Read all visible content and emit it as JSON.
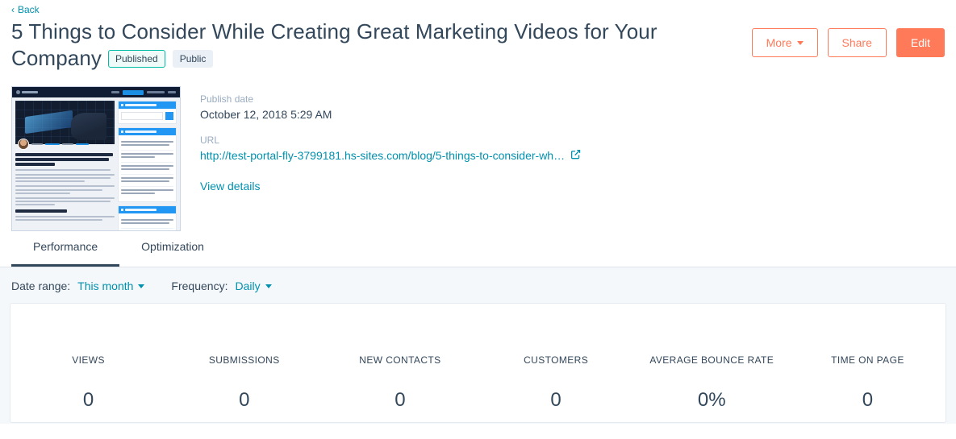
{
  "back": {
    "label": "Back",
    "icon": "chevron-left-icon"
  },
  "header": {
    "title": "5 Things to Consider While Creating Great Marketing Videos for Your Company",
    "badges": [
      {
        "label": "Published",
        "color": "#00bda5"
      },
      {
        "label": "Public",
        "color": "#eaf0f6"
      }
    ],
    "actions": [
      {
        "label": "More",
        "style": "secondary",
        "icon": "caret-down-icon"
      },
      {
        "label": "Share",
        "style": "secondary"
      },
      {
        "label": "Edit",
        "style": "primary"
      }
    ],
    "accent_color": "#ff7a59"
  },
  "preview": {
    "thumbnail_name": "blog-post-preview-thumbnail",
    "post_title": "5 Things to Consider While Creating Great Marketing Videos for Your Company",
    "section_heading": "1. Know Your Audience",
    "sidebar_widgets": [
      "Blog Search",
      "Posts Popular",
      "Recent Posts"
    ]
  },
  "details": {
    "publish_date_label": "Publish date",
    "publish_date": "October 12, 2018 5:29 AM",
    "url_label": "URL",
    "url": "http://test-portal-fly-3799181.hs-sites.com/blog/5-things-to-consider-wh…",
    "url_icon": "external-link-icon",
    "view_details": "View details"
  },
  "tabs": [
    {
      "label": "Performance",
      "active": true
    },
    {
      "label": "Optimization",
      "active": false
    }
  ],
  "filters": {
    "date_range_label": "Date range:",
    "date_range_value": "This month",
    "frequency_label": "Frequency:",
    "frequency_value": "Daily"
  },
  "metrics": [
    {
      "label": "VIEWS",
      "value": "0"
    },
    {
      "label": "SUBMISSIONS",
      "value": "0"
    },
    {
      "label": "NEW CONTACTS",
      "value": "0"
    },
    {
      "label": "CUSTOMERS",
      "value": "0"
    },
    {
      "label": "AVERAGE BOUNCE RATE",
      "value": "0%"
    },
    {
      "label": "TIME ON PAGE",
      "value": "0"
    }
  ]
}
